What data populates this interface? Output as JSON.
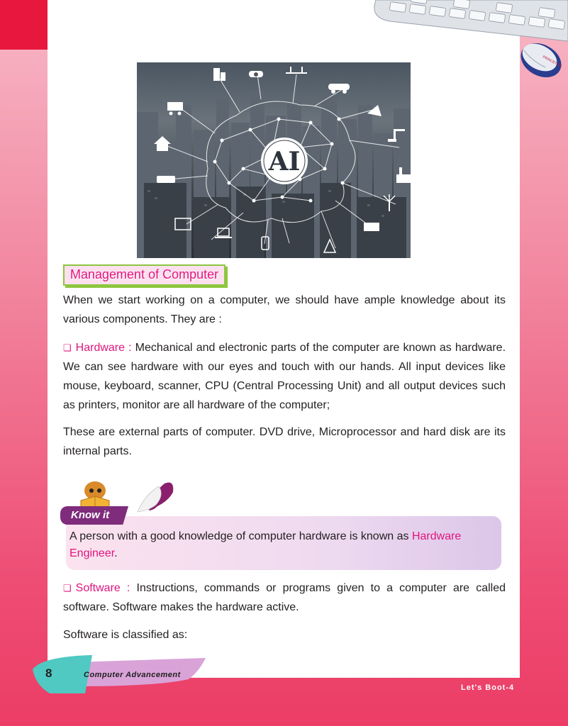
{
  "hero": {
    "label": "AI"
  },
  "section": {
    "heading": "Management of Computer"
  },
  "intro": "When we start working on a computer, we should have ample knowledge about its various components. They are :",
  "hardware": {
    "term": "Hardware :",
    "text": "Mechanical and electronic parts of the computer are known as hardware. We can see hardware with our eyes and touch with our hands. All input devices like mouse, keyboard, scanner, CPU (Central Processing Unit) and all output devices such as printers, monitor are all hardware of the computer;"
  },
  "external": "These are external parts of computer. DVD drive, Microprocessor and hard disk are its internal parts.",
  "know_it": {
    "tag": "Know it",
    "text_before": "A person with a good knowledge of computer hardware is known as ",
    "highlight": "Hardware Engineer",
    "text_after": "."
  },
  "software": {
    "term": "Software :",
    "text": "Instructions, commands or programs given to a computer are called software. Software makes the hardware active."
  },
  "classified": "Software is classified as:",
  "footer": {
    "page_number": "8",
    "chapter": "Computer Advancement",
    "series": "Let's Boot-4"
  },
  "colors": {
    "accent": "#e0157e",
    "brand_red": "#e8173e",
    "purple": "#7e2c7b",
    "green": "#8dc63f"
  },
  "icons": [
    "bullet-square-icon",
    "reading-book-icon",
    "keyboard-icon",
    "mouse-icon",
    "building-icon",
    "camera-icon",
    "bridge-icon",
    "car-icon",
    "cart-icon",
    "house-icon",
    "air-conditioner-icon",
    "robot-arm-icon",
    "factory-icon",
    "wind-turbine-icon",
    "monitor-icon",
    "laptop-icon",
    "phone-icon",
    "tower-icon",
    "solar-panel-icon"
  ]
}
